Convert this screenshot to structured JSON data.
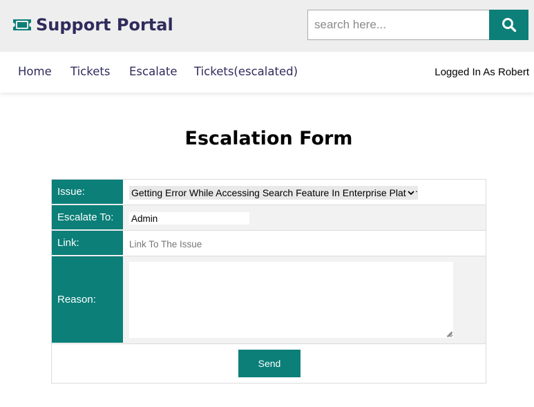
{
  "brand": {
    "name": "Support Portal",
    "icon": "ticket-icon"
  },
  "search": {
    "placeholder": "search here...",
    "icon": "search-icon"
  },
  "nav": {
    "items": [
      "Home",
      "Tickets",
      "Escalate",
      "Tickets(escalated)"
    ],
    "logged_in": "Logged In As Robert"
  },
  "page": {
    "title": "Escalation Form"
  },
  "form": {
    "issue_label": "Issue:",
    "issue_value": "Getting Error While Accessing Search Feature In Enterprise Platform",
    "escalate_label": "Escalate To:",
    "escalate_value": "Admin",
    "link_label": "Link:",
    "link_placeholder": "Link To The Issue",
    "reason_label": "Reason:",
    "send_label": "Send"
  },
  "colors": {
    "accent": "#0b7f78",
    "brand_text": "#2f2b5c",
    "header_bg": "#eeeeee"
  }
}
